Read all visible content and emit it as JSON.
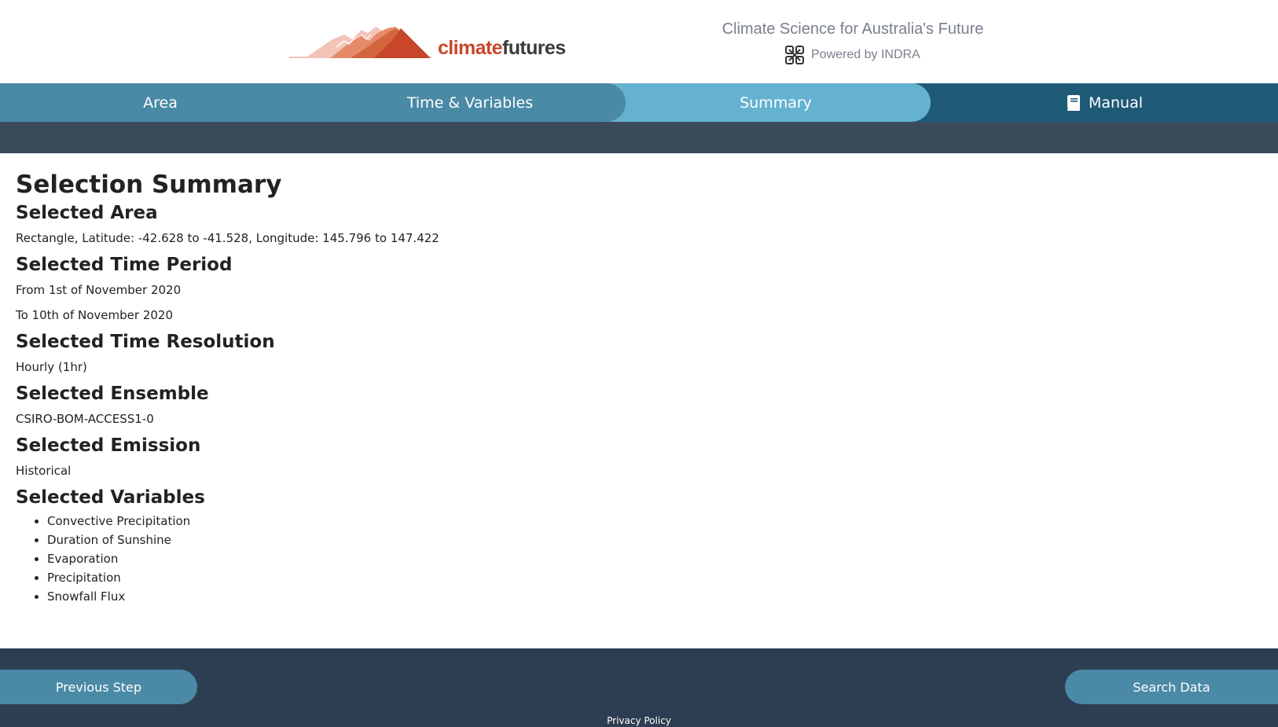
{
  "brand": {
    "logo_text_part1": "climate",
    "logo_text_part2": "futures",
    "tagline": "Climate Science for Australia's Future",
    "powered_by": "Powered by INDRA",
    "logo_icon": "mountain-logo-icon",
    "powered_icon": "indra-knot-icon",
    "colors": {
      "logo_orange": "#c8472a",
      "logo_dark": "#3b3b3b",
      "tagline_grey": "#7a7f8e"
    }
  },
  "tabs": [
    {
      "label": "Area"
    },
    {
      "label": "Time & Variables"
    },
    {
      "label": "Summary",
      "active": true
    },
    {
      "label": "Manual",
      "icon": "book-icon"
    }
  ],
  "summary": {
    "title": "Selection Summary",
    "area": {
      "heading": "Selected Area",
      "value": "Rectangle, Latitude: -42.628 to -41.528, Longitude: 145.796 to 147.422"
    },
    "time_period": {
      "heading": "Selected Time Period",
      "from": "From 1st of November 2020",
      "to": "To 10th of November 2020"
    },
    "time_resolution": {
      "heading": "Selected Time Resolution",
      "value": "Hourly (1hr)"
    },
    "ensemble": {
      "heading": "Selected Ensemble",
      "value": "CSIRO-BOM-ACCESS1-0"
    },
    "emission": {
      "heading": "Selected Emission",
      "value": "Historical"
    },
    "variables": {
      "heading": "Selected Variables",
      "items": [
        "Convective Precipitation",
        "Duration of Sunshine",
        "Evaporation",
        "Precipitation",
        "Snowfall Flux"
      ]
    }
  },
  "footer": {
    "previous_label": "Previous Step",
    "search_label": "Search Data",
    "privacy_label": "Privacy Policy"
  },
  "colors": {
    "tab_bar": "#1e5a76",
    "tab": "#4a8aa6",
    "tab_active": "#64b2d0",
    "subbar": "#3c4b5c",
    "footer": "#2e3e52"
  }
}
